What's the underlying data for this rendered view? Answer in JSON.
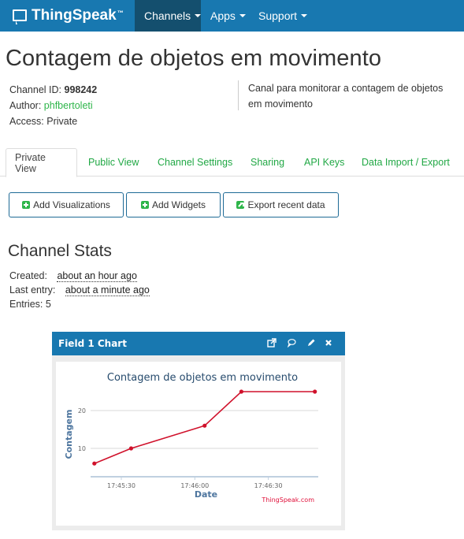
{
  "navbar": {
    "brand": "ThingSpeak",
    "trademark": "™",
    "items": [
      {
        "label": "Channels",
        "active": true
      },
      {
        "label": "Apps",
        "active": false
      },
      {
        "label": "Support",
        "active": false
      }
    ]
  },
  "channel": {
    "title": "Contagem de objetos em movimento",
    "id_label": "Channel ID:",
    "id": "998242",
    "author_label": "Author:",
    "author": "phfbertoleti",
    "access_label": "Access:",
    "access": "Private",
    "description": "Canal para monitorar a contagem de objetos em movimento"
  },
  "tabs": [
    {
      "label": "Private View",
      "active": true
    },
    {
      "label": "Public View",
      "active": false
    },
    {
      "label": "Channel Settings",
      "active": false
    },
    {
      "label": "Sharing",
      "active": false
    },
    {
      "label": "API Keys",
      "active": false
    },
    {
      "label": "Data Import / Export",
      "active": false
    }
  ],
  "buttons": {
    "add_visualizations": "Add Visualizations",
    "add_widgets": "Add Widgets",
    "export_recent": "Export recent data"
  },
  "stats": {
    "title": "Channel Stats",
    "created_label": "Created:",
    "created": "about an hour ago",
    "last_entry_label": "Last entry:",
    "last_entry": "about a minute ago",
    "entries_label": "Entries:",
    "entries": "5"
  },
  "widget": {
    "title": "Field 1 Chart",
    "icons": [
      "external-link-icon",
      "comment-icon",
      "pencil-icon",
      "close-icon"
    ]
  },
  "colors": {
    "navbar": "#1878b0",
    "navbar_active": "#144f6e",
    "link_green": "#21a845",
    "series": "#d0112b"
  },
  "chart_data": {
    "type": "line",
    "title": "Contagem de objetos em movimento",
    "xlabel": "Date",
    "ylabel": "Contagem",
    "credit": "ThingSpeak.com",
    "x": [
      "17:45:19",
      "17:45:34",
      "17:46:04",
      "17:46:19",
      "17:46:49"
    ],
    "x_seconds": [
      -11,
      4,
      34,
      49,
      79
    ],
    "values": [
      6,
      10,
      16,
      25,
      25
    ],
    "x_ticks": [
      "17:45:30",
      "17:46:00",
      "17:46:30"
    ],
    "x_tick_seconds": [
      0,
      30,
      60
    ],
    "y_ticks": [
      10,
      20
    ],
    "ylim": [
      2.5,
      27.5
    ],
    "grid": true,
    "legend": "none"
  }
}
